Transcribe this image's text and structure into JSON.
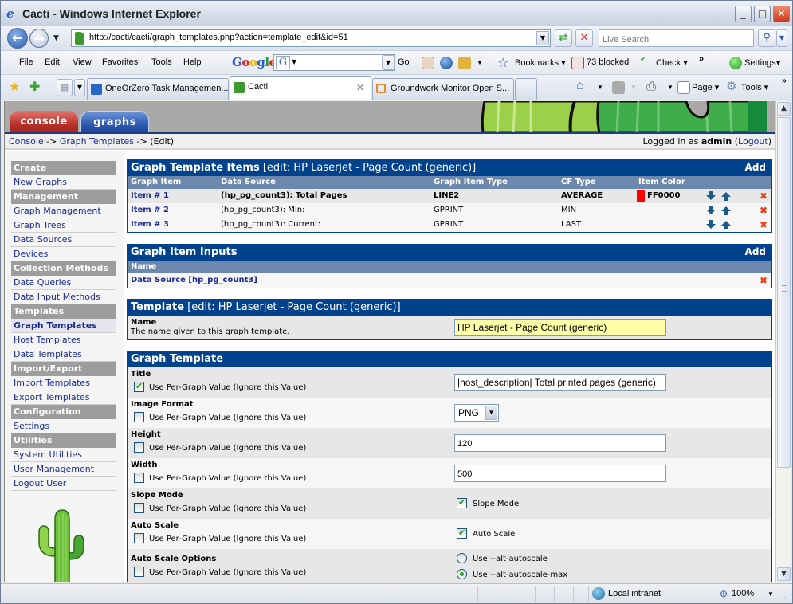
{
  "browser": {
    "title": "Cacti - Windows Internet Explorer",
    "address": "http://cacti/cacti/graph_templates.php?action=template_edit&id=51",
    "search_placeholder": "Live Search",
    "menu": [
      "File",
      "Edit",
      "View",
      "Favorites",
      "Tools",
      "Help"
    ],
    "google_label": "Google",
    "go_label": "Go",
    "bookmarks_label": "Bookmarks",
    "blocked_label": "73 blocked",
    "check_label": "Check",
    "settings_label": "Settings",
    "tabs": [
      {
        "label": "OneOrZero Task Managemen...",
        "active": false
      },
      {
        "label": "Cacti",
        "active": true
      },
      {
        "label": "Groundwork Monitor Open S...",
        "active": false
      }
    ],
    "commands": {
      "page": "Page",
      "tools": "Tools"
    },
    "status": {
      "zone": "Local intranet",
      "zoom": "100%"
    }
  },
  "cacti": {
    "tabs": {
      "console": "console",
      "graphs": "graphs"
    },
    "breadcrumb": {
      "console": "Console",
      "sep1": " -> ",
      "graph_templates": "Graph Templates",
      "sep2": " -> ",
      "current": "(Edit)"
    },
    "login": {
      "prefix": "Logged in as ",
      "user": "admin",
      "logout": "Logout"
    },
    "sidebar": [
      {
        "type": "header",
        "label": "Create"
      },
      {
        "type": "item",
        "label": "New Graphs"
      },
      {
        "type": "header",
        "label": "Management"
      },
      {
        "type": "item",
        "label": "Graph Management"
      },
      {
        "type": "item",
        "label": "Graph Trees"
      },
      {
        "type": "item",
        "label": "Data Sources"
      },
      {
        "type": "item",
        "label": "Devices"
      },
      {
        "type": "header",
        "label": "Collection Methods"
      },
      {
        "type": "item",
        "label": "Data Queries"
      },
      {
        "type": "item",
        "label": "Data Input Methods"
      },
      {
        "type": "header",
        "label": "Templates"
      },
      {
        "type": "item",
        "label": "Graph Templates",
        "selected": true
      },
      {
        "type": "item",
        "label": "Host Templates"
      },
      {
        "type": "item",
        "label": "Data Templates"
      },
      {
        "type": "header",
        "label": "Import/Export"
      },
      {
        "type": "item",
        "label": "Import Templates"
      },
      {
        "type": "item",
        "label": "Export Templates"
      },
      {
        "type": "header",
        "label": "Configuration"
      },
      {
        "type": "item",
        "label": "Settings"
      },
      {
        "type": "header",
        "label": "Utilities"
      },
      {
        "type": "item",
        "label": "System Utilities"
      },
      {
        "type": "item",
        "label": "User Management"
      },
      {
        "type": "item",
        "label": "Logout User"
      }
    ],
    "items_panel": {
      "title": "Graph Template Items",
      "subtitle": " [edit: HP Laserjet - Page Count (generic)]",
      "add": "Add",
      "columns": [
        "Graph Item",
        "Data Source",
        "Graph Item Type",
        "CF Type",
        "Item Color"
      ],
      "rows": [
        {
          "item": "Item # 1",
          "source": "(hp_pg_count3): Total Pages",
          "type": "LINE2",
          "cf": "AVERAGE",
          "color": "FF0000",
          "color_hex": "#FF0000",
          "bold": true
        },
        {
          "item": "Item # 2",
          "source": "(hp_pg_count3): Min:",
          "type": "GPRINT",
          "cf": "MIN",
          "color": "",
          "bold": false
        },
        {
          "item": "Item # 3",
          "source": "(hp_pg_count3): Current:",
          "type": "GPRINT",
          "cf": "LAST",
          "color": "",
          "bold": false
        }
      ]
    },
    "inputs_panel": {
      "title": "Graph Item Inputs",
      "add": "Add",
      "column": "Name",
      "rows": [
        {
          "name": "Data Source [hp_pg_count3]"
        }
      ]
    },
    "template_panel": {
      "title": "Template",
      "subtitle": " [edit: HP Laserjet - Page Count (generic)]",
      "name_label": "Name",
      "name_desc": "The name given to this graph template.",
      "name_value": "HP Laserjet - Page Count (generic)"
    },
    "graph_template_panel": {
      "title": "Graph Template",
      "per_graph_label": "Use Per-Graph Value (Ignore this Value)",
      "fields": {
        "title": {
          "label": "Title",
          "per_graph": true,
          "value": "|host_description| Total printed pages (generic)"
        },
        "image_format": {
          "label": "Image Format",
          "per_graph": false,
          "value": "PNG"
        },
        "height": {
          "label": "Height",
          "per_graph": false,
          "value": "120"
        },
        "width": {
          "label": "Width",
          "per_graph": false,
          "value": "500"
        },
        "slope_mode": {
          "label": "Slope Mode",
          "per_graph": false,
          "checkbox_label": "Slope Mode",
          "checked": true
        },
        "auto_scale": {
          "label": "Auto Scale",
          "per_graph": false,
          "checkbox_label": "Auto Scale",
          "checked": true
        },
        "auto_scale_options": {
          "label": "Auto Scale Options",
          "per_graph": false,
          "options": [
            "Use --alt-autoscale",
            "Use --alt-autoscale-max"
          ],
          "selected": 1
        }
      }
    }
  }
}
